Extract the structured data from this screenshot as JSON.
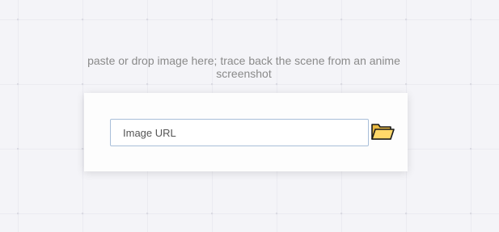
{
  "instruction": {
    "text": "paste or drop image here; trace back the scene from an anime screenshot"
  },
  "search": {
    "placeholder": "Image URL",
    "value": ""
  },
  "folder_button": {
    "icon": "folder-icon",
    "fill_color": "#ffd86a",
    "stroke_color": "#1a1a1a"
  },
  "colors": {
    "background": "#f4f4f8",
    "panel": "#fdfdfd",
    "input_border": "#a9bfd9",
    "instruction_text": "#8a8a8a"
  }
}
